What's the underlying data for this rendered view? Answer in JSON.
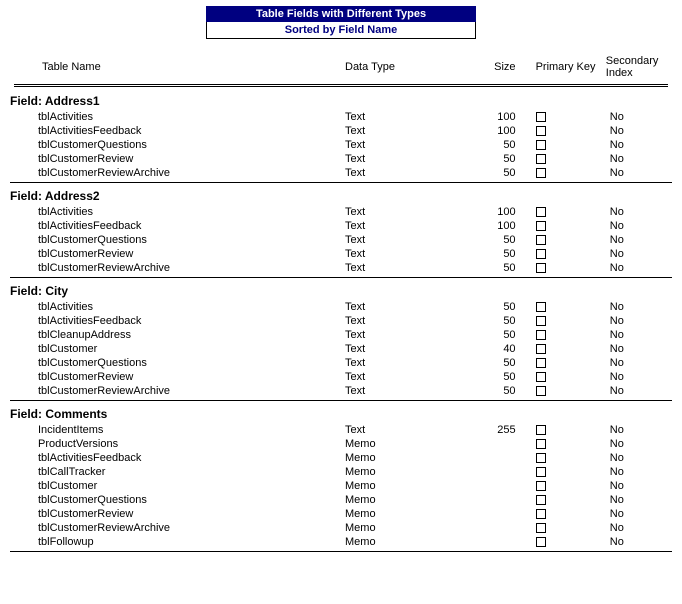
{
  "title": "Table Fields with Different Types",
  "subtitle": "Sorted by Field Name",
  "columns": {
    "tableName": "Table Name",
    "dataType": "Data Type",
    "size": "Size",
    "primaryKey": "Primary Key",
    "secondaryIndex": "Secondary Index"
  },
  "fieldLabelPrefix": "Field: ",
  "groups": [
    {
      "field": "Address1",
      "rows": [
        {
          "tn": "tblActivities",
          "dt": "Text",
          "sz": "100",
          "pk": false,
          "si": "No"
        },
        {
          "tn": "tblActivitiesFeedback",
          "dt": "Text",
          "sz": "100",
          "pk": false,
          "si": "No"
        },
        {
          "tn": "tblCustomerQuestions",
          "dt": "Text",
          "sz": "50",
          "pk": false,
          "si": "No"
        },
        {
          "tn": "tblCustomerReview",
          "dt": "Text",
          "sz": "50",
          "pk": false,
          "si": "No"
        },
        {
          "tn": "tblCustomerReviewArchive",
          "dt": "Text",
          "sz": "50",
          "pk": false,
          "si": "No"
        }
      ]
    },
    {
      "field": "Address2",
      "rows": [
        {
          "tn": "tblActivities",
          "dt": "Text",
          "sz": "100",
          "pk": false,
          "si": "No"
        },
        {
          "tn": "tblActivitiesFeedback",
          "dt": "Text",
          "sz": "100",
          "pk": false,
          "si": "No"
        },
        {
          "tn": "tblCustomerQuestions",
          "dt": "Text",
          "sz": "50",
          "pk": false,
          "si": "No"
        },
        {
          "tn": "tblCustomerReview",
          "dt": "Text",
          "sz": "50",
          "pk": false,
          "si": "No"
        },
        {
          "tn": "tblCustomerReviewArchive",
          "dt": "Text",
          "sz": "50",
          "pk": false,
          "si": "No"
        }
      ]
    },
    {
      "field": "City",
      "rows": [
        {
          "tn": "tblActivities",
          "dt": "Text",
          "sz": "50",
          "pk": false,
          "si": "No"
        },
        {
          "tn": "tblActivitiesFeedback",
          "dt": "Text",
          "sz": "50",
          "pk": false,
          "si": "No"
        },
        {
          "tn": "tblCleanupAddress",
          "dt": "Text",
          "sz": "50",
          "pk": false,
          "si": "No"
        },
        {
          "tn": "tblCustomer",
          "dt": "Text",
          "sz": "40",
          "pk": false,
          "si": "No"
        },
        {
          "tn": "tblCustomerQuestions",
          "dt": "Text",
          "sz": "50",
          "pk": false,
          "si": "No"
        },
        {
          "tn": "tblCustomerReview",
          "dt": "Text",
          "sz": "50",
          "pk": false,
          "si": "No"
        },
        {
          "tn": "tblCustomerReviewArchive",
          "dt": "Text",
          "sz": "50",
          "pk": false,
          "si": "No"
        }
      ]
    },
    {
      "field": "Comments",
      "rows": [
        {
          "tn": "IncidentItems",
          "dt": "Text",
          "sz": "255",
          "pk": false,
          "si": "No"
        },
        {
          "tn": "ProductVersions",
          "dt": "Memo",
          "sz": "",
          "pk": false,
          "si": "No"
        },
        {
          "tn": "tblActivitiesFeedback",
          "dt": "Memo",
          "sz": "",
          "pk": false,
          "si": "No"
        },
        {
          "tn": "tblCallTracker",
          "dt": "Memo",
          "sz": "",
          "pk": false,
          "si": "No"
        },
        {
          "tn": "tblCustomer",
          "dt": "Memo",
          "sz": "",
          "pk": false,
          "si": "No"
        },
        {
          "tn": "tblCustomerQuestions",
          "dt": "Memo",
          "sz": "",
          "pk": false,
          "si": "No"
        },
        {
          "tn": "tblCustomerReview",
          "dt": "Memo",
          "sz": "",
          "pk": false,
          "si": "No"
        },
        {
          "tn": "tblCustomerReviewArchive",
          "dt": "Memo",
          "sz": "",
          "pk": false,
          "si": "No"
        },
        {
          "tn": "tblFollowup",
          "dt": "Memo",
          "sz": "",
          "pk": false,
          "si": "No"
        }
      ]
    }
  ]
}
